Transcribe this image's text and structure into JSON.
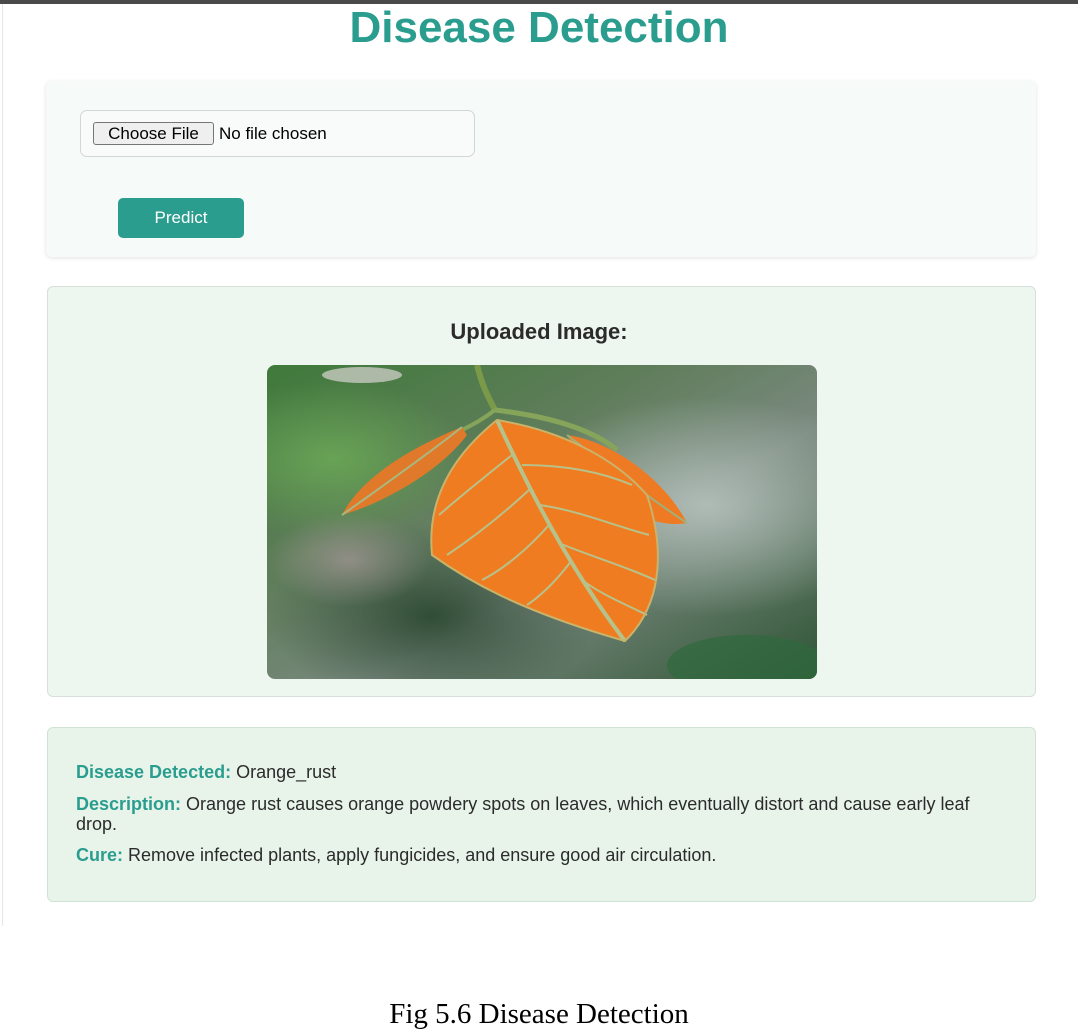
{
  "page": {
    "title": "Disease Detection"
  },
  "upload": {
    "choose_file_label": "Choose File",
    "file_status": "No file chosen",
    "predict_label": "Predict"
  },
  "preview": {
    "heading": "Uploaded Image:"
  },
  "result": {
    "disease_label": "Disease Detected:",
    "disease_value": "Orange_rust",
    "description_label": "Description:",
    "description_value": "Orange rust causes orange powdery spots on leaves, which eventually distort and cause early leaf drop.",
    "cure_label": "Cure:",
    "cure_value": "Remove infected plants, apply fungicides, and ensure good air circulation."
  },
  "caption": "Fig 5.6 Disease Detection",
  "colors": {
    "accent": "#2a9d8f",
    "result_background": "#e8f4ea",
    "preview_background": "#eef6f0"
  },
  "icons": {
    "uploaded_image": "leaf-photo-orange-rust"
  }
}
